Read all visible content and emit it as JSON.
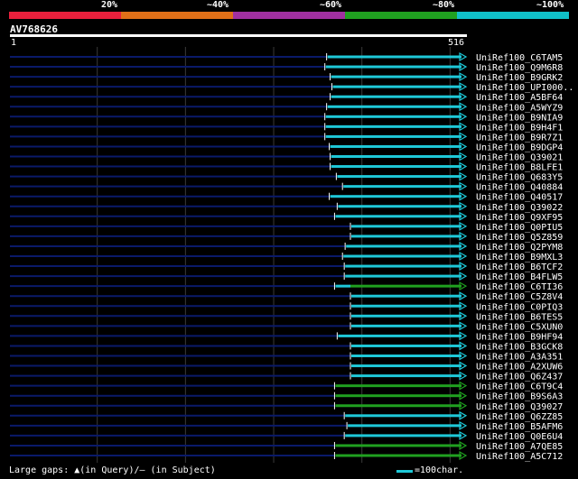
{
  "color_scale": {
    "labels": [
      "20%",
      "~40%",
      "~60%",
      "~80%",
      "~100%"
    ],
    "colors": [
      "#e8203c",
      "#e07018",
      "#a030a0",
      "#20a020",
      "#10c0c8"
    ]
  },
  "query": {
    "name": "AV768626",
    "start_label": "1",
    "end_label": "516"
  },
  "legend": {
    "gaps_text": "Large gaps: ▲(in Query)/– (in Subject)",
    "scale_text": "=100char."
  },
  "chart_data": {
    "type": "alignment",
    "query_length": 516,
    "hits": [
      {
        "name": "UniRef100_C6TAM5",
        "start": 360,
        "end": 516,
        "color": "#1ec8d8"
      },
      {
        "name": "UniRef100_Q9M6R8",
        "start": 358,
        "end": 516,
        "color": "#1ec8d8"
      },
      {
        "name": "UniRef100_B9GRK2",
        "start": 364,
        "end": 516,
        "color": "#1ec8d8"
      },
      {
        "name": "UniRef100_UPI000..",
        "start": 366,
        "end": 516,
        "color": "#1ec8d8"
      },
      {
        "name": "UniRef100_A5BF64",
        "start": 364,
        "end": 516,
        "color": "#1ec8d8"
      },
      {
        "name": "UniRef100_A5WYZ9",
        "start": 360,
        "end": 516,
        "color": "#1ec8d8"
      },
      {
        "name": "UniRef100_B9NIA9",
        "start": 358,
        "end": 516,
        "color": "#1ec8d8"
      },
      {
        "name": "UniRef100_B9H4F1",
        "start": 358,
        "end": 516,
        "color": "#1ec8d8"
      },
      {
        "name": "UniRef100_B9R7Z1",
        "start": 358,
        "end": 516,
        "color": "#1ec8d8"
      },
      {
        "name": "UniRef100_B9DGP4",
        "start": 363,
        "end": 516,
        "color": "#1ec8d8"
      },
      {
        "name": "UniRef100_Q39021",
        "start": 364,
        "end": 516,
        "color": "#1ec8d8"
      },
      {
        "name": "UniRef100_B8LFE1",
        "start": 364,
        "end": 516,
        "color": "#1ec8d8"
      },
      {
        "name": "UniRef100_Q683Y5",
        "start": 371,
        "end": 516,
        "color": "#1ec8d8"
      },
      {
        "name": "UniRef100_Q40884",
        "start": 378,
        "end": 516,
        "color": "#1ec8d8"
      },
      {
        "name": "UniRef100_Q40517",
        "start": 363,
        "end": 516,
        "color": "#1ec8d8"
      },
      {
        "name": "UniRef100_Q39022",
        "start": 372,
        "end": 516,
        "color": "#1ec8d8"
      },
      {
        "name": "UniRef100_Q9XF95",
        "start": 369,
        "end": 516,
        "color": "#1ec8d8"
      },
      {
        "name": "UniRef100_Q0PIU5",
        "start": 387,
        "end": 516,
        "color": "#1ec8d8"
      },
      {
        "name": "UniRef100_Q5Z859",
        "start": 387,
        "end": 516,
        "color": "#1ec8d8"
      },
      {
        "name": "UniRef100_Q2PYM8",
        "start": 381,
        "end": 516,
        "color": "#1ec8d8"
      },
      {
        "name": "UniRef100_B9MXL3",
        "start": 378,
        "end": 516,
        "color": "#1ec8d8"
      },
      {
        "name": "UniRef100_B6TCF2",
        "start": 380,
        "end": 516,
        "color": "#1ec8d8"
      },
      {
        "name": "UniRef100_B4FLW5",
        "start": 380,
        "end": 516,
        "color": "#1ec8d8"
      },
      {
        "name": "UniRef100_C6TI36",
        "start": 369,
        "end": 516,
        "color": "#20a020",
        "pre_color": "#1ec8d8",
        "pre_end": 387
      },
      {
        "name": "UniRef100_C5Z8V4",
        "start": 387,
        "end": 516,
        "color": "#1ec8d8"
      },
      {
        "name": "UniRef100_C0PIQ3",
        "start": 387,
        "end": 516,
        "color": "#1ec8d8"
      },
      {
        "name": "UniRef100_B6TES5",
        "start": 387,
        "end": 516,
        "color": "#1ec8d8"
      },
      {
        "name": "UniRef100_C5XUN0",
        "start": 387,
        "end": 516,
        "color": "#1ec8d8"
      },
      {
        "name": "UniRef100_B9HF94",
        "start": 372,
        "end": 516,
        "color": "#1ec8d8"
      },
      {
        "name": "UniRef100_B3GCK8",
        "start": 387,
        "end": 516,
        "color": "#1ec8d8"
      },
      {
        "name": "UniRef100_A3A351",
        "start": 387,
        "end": 516,
        "color": "#1ec8d8"
      },
      {
        "name": "UniRef100_A2XUW6",
        "start": 387,
        "end": 516,
        "color": "#1ec8d8"
      },
      {
        "name": "UniRef100_Q6Z437",
        "start": 387,
        "end": 516,
        "color": "#1ec8d8"
      },
      {
        "name": "UniRef100_C6T9C4",
        "start": 369,
        "end": 516,
        "color": "#20a020"
      },
      {
        "name": "UniRef100_B9S6A3",
        "start": 369,
        "end": 516,
        "color": "#20a020"
      },
      {
        "name": "UniRef100_Q39027",
        "start": 369,
        "end": 516,
        "color": "#20a020"
      },
      {
        "name": "UniRef100_Q6ZZ85",
        "start": 380,
        "end": 516,
        "color": "#1ec8d8"
      },
      {
        "name": "UniRef100_B5AFM6",
        "start": 383,
        "end": 516,
        "color": "#1ec8d8"
      },
      {
        "name": "UniRef100_Q0E6U4",
        "start": 380,
        "end": 516,
        "color": "#1ec8d8"
      },
      {
        "name": "UniRef100_A7QE85",
        "start": 369,
        "end": 516,
        "color": "#20a020"
      },
      {
        "name": "UniRef100_A5C712",
        "start": 369,
        "end": 516,
        "color": "#20a020"
      }
    ],
    "gridlines": [
      100,
      200,
      300,
      400,
      500
    ]
  }
}
